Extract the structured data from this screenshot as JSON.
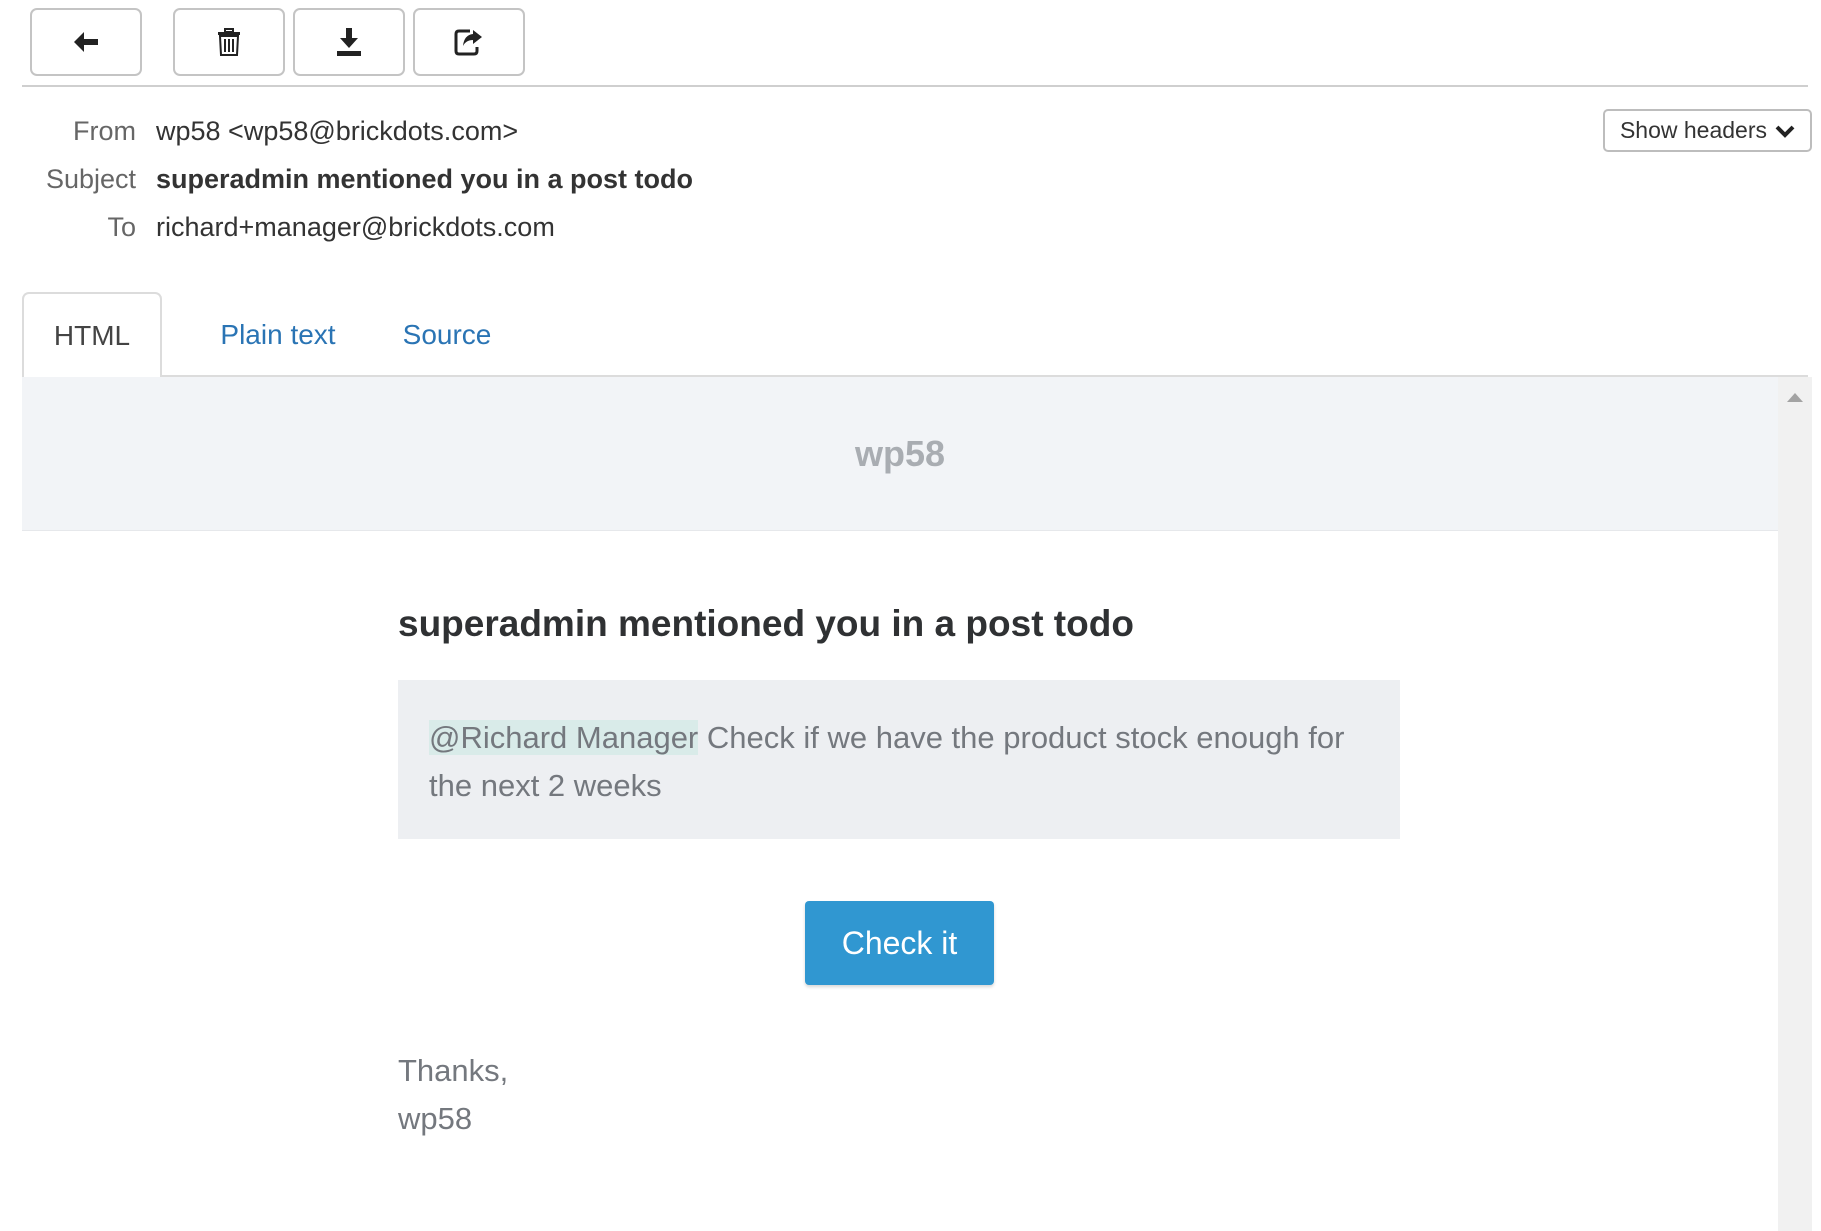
{
  "toolbar": {
    "buttons": [
      {
        "name": "back-button",
        "icon": "arrow-left-icon"
      },
      {
        "name": "delete-button",
        "icon": "trash-icon"
      },
      {
        "name": "download-button",
        "icon": "download-icon"
      },
      {
        "name": "forward-button",
        "icon": "share-icon"
      }
    ]
  },
  "headers": {
    "from_label": "From",
    "from_value": "wp58 <wp58@brickdots.com>",
    "subject_label": "Subject",
    "subject_value": "superadmin mentioned you in a post todo",
    "to_label": "To",
    "to_value": "richard+manager@brickdots.com",
    "show_headers_label": "Show headers"
  },
  "tabs": [
    {
      "label": "HTML",
      "active": true
    },
    {
      "label": "Plain text",
      "active": false
    },
    {
      "label": "Source",
      "active": false
    }
  ],
  "email": {
    "banner_title": "wp58",
    "post_title": "superadmin mentioned you in a post todo",
    "mention": "@Richard Manager",
    "message": " Check if we have the product stock enough for the next 2 weeks",
    "cta_label": "Check it",
    "thanks": "Thanks,",
    "signature": "wp58"
  },
  "colors": {
    "link": "#2a74b4",
    "button": "#3097d1",
    "banner_bg": "#f2f4f7",
    "quote_bg": "#edeff2",
    "mention_bg": "#d9ebe9"
  }
}
